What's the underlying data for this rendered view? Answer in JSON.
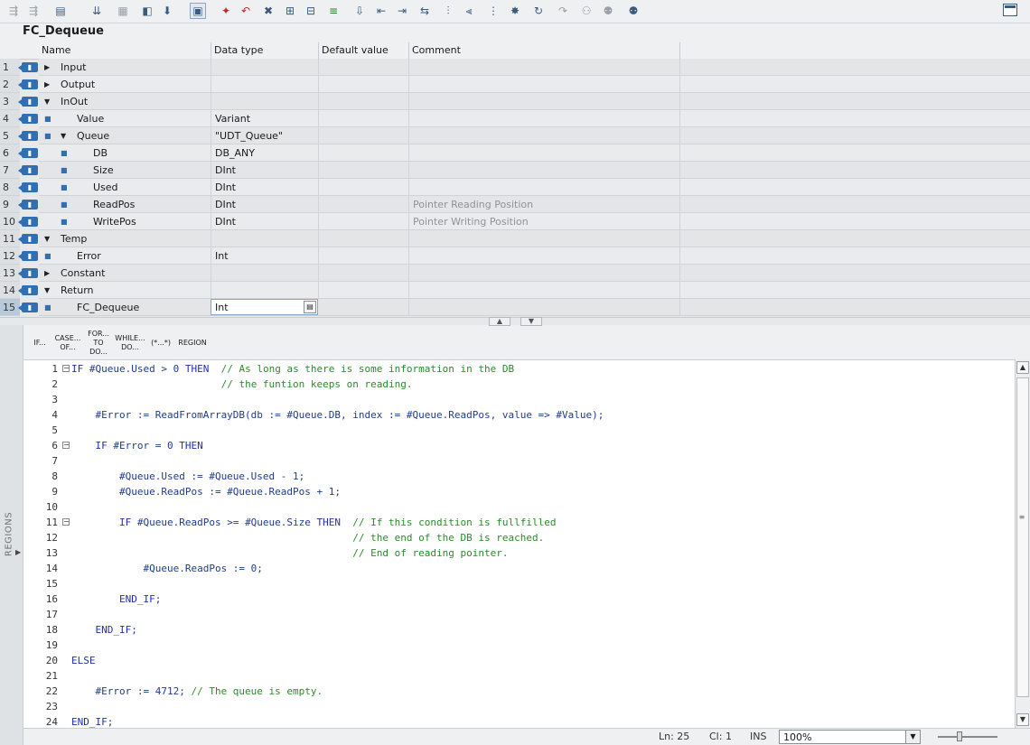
{
  "toolbar": {
    "icons": [
      "compile-icon",
      "compile-all-icon",
      "insert-row-icon",
      "add-row-icon",
      "delete-row-icon",
      "monitor-icon",
      "download-icon",
      "snapshot-icon",
      "favorite-icon",
      "error-prev-icon",
      "error-next-icon",
      "bookmark-icon",
      "bookmark-next-icon",
      "comment-icon",
      "absolute-icon",
      "indent-icon",
      "outdent-icon",
      "align-icon",
      "expand-icon",
      "collapse-icon",
      "new-line-icon",
      "call-icon",
      "jump-icon",
      "goto-icon",
      "watch-icon",
      "watch-table-icon",
      "watch-toggle-icon",
      "memory-icon",
      "window-layout-icon"
    ]
  },
  "block": {
    "title": "FC_Dequeue"
  },
  "interface": {
    "columns": [
      "Name",
      "Data type",
      "Default value",
      "Comment"
    ],
    "rows": [
      {
        "num": "1",
        "name": "Input",
        "type": "",
        "default": "",
        "comment": ""
      },
      {
        "num": "2",
        "name": "Output",
        "type": "",
        "default": "",
        "comment": ""
      },
      {
        "num": "3",
        "name": "InOut",
        "type": "",
        "default": "",
        "comment": ""
      },
      {
        "num": "4",
        "name": "Value",
        "type": "Variant",
        "default": "",
        "comment": ""
      },
      {
        "num": "5",
        "name": "Queue",
        "type": "\"UDT_Queue\"",
        "default": "",
        "comment": ""
      },
      {
        "num": "6",
        "name": "DB",
        "type": "DB_ANY",
        "default": "",
        "comment": ""
      },
      {
        "num": "7",
        "name": "Size",
        "type": "DInt",
        "default": "",
        "comment": ""
      },
      {
        "num": "8",
        "name": "Used",
        "type": "DInt",
        "default": "",
        "comment": ""
      },
      {
        "num": "9",
        "name": "ReadPos",
        "type": "DInt",
        "default": "",
        "comment": "Pointer Reading Position"
      },
      {
        "num": "10",
        "name": "WritePos",
        "type": "DInt",
        "default": "",
        "comment": "Pointer Writing Position"
      },
      {
        "num": "11",
        "name": "Temp",
        "type": "",
        "default": "",
        "comment": ""
      },
      {
        "num": "12",
        "name": "Error",
        "type": "Int",
        "default": "",
        "comment": ""
      },
      {
        "num": "13",
        "name": "Constant",
        "type": "",
        "default": "",
        "comment": ""
      },
      {
        "num": "14",
        "name": "Return",
        "type": "",
        "default": "",
        "comment": ""
      },
      {
        "num": "15",
        "name": "FC_Dequeue",
        "type": "Int",
        "default": "",
        "comment": ""
      }
    ]
  },
  "regions_label": "REGIONS",
  "instructions": [
    {
      "line1": "IF...",
      "line2": ""
    },
    {
      "line1": "CASE...",
      "line2": "OF..."
    },
    {
      "line1": "FOR...",
      "line2": "TO DO..."
    },
    {
      "line1": "WHILE...",
      "line2": "DO..."
    },
    {
      "line1": "(*...*)",
      "line2": ""
    },
    {
      "line1": "REGION",
      "line2": ""
    }
  ],
  "code": {
    "lines": [
      "IF #Queue.Used > 0 THEN  // As long as there is some information in the DB",
      "                         // the funtion keeps on reading.",
      "",
      "    #Error := ReadFromArrayDB(db := #Queue.DB, index := #Queue.ReadPos, value => #Value);",
      "",
      "    IF #Error = 0 THEN",
      "",
      "        #Queue.Used := #Queue.Used - 1;",
      "        #Queue.ReadPos := #Queue.ReadPos + 1;",
      "",
      "        IF #Queue.ReadPos >= #Queue.Size THEN  // If this condition is fullfilled",
      "                                               // the end of the DB is reached.",
      "                                               // End of reading pointer.",
      "            #Queue.ReadPos := 0;",
      "",
      "        END_IF;",
      "",
      "    END_IF;",
      "",
      "ELSE",
      "",
      "    #Error := 4712; // The queue is empty.",
      "",
      "END_IF;"
    ]
  },
  "status": {
    "line": "Ln: 25",
    "col": "Cl: 1",
    "mode": "INS",
    "zoom": "100%"
  }
}
